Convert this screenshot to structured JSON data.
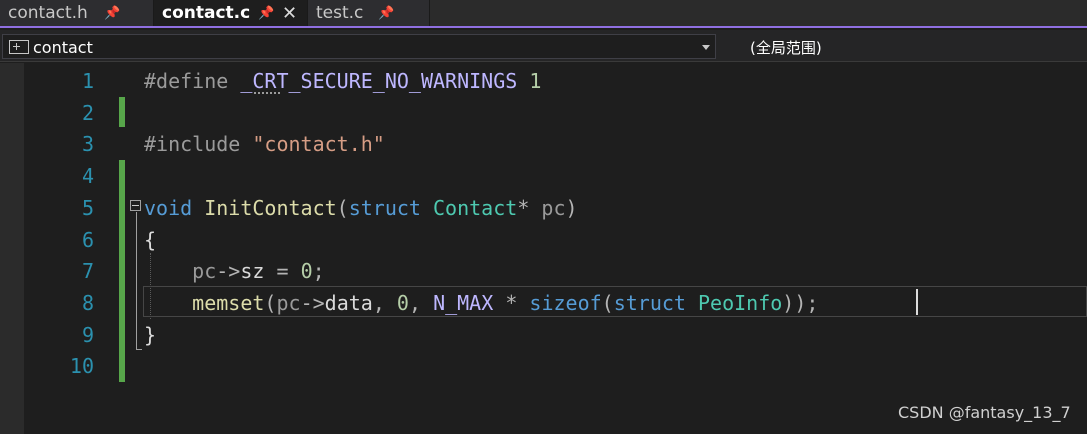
{
  "tabs": [
    {
      "label": "contact.h",
      "pin": "📌",
      "active": false
    },
    {
      "label": "contact.c",
      "pin": "📌",
      "close": "✕",
      "active": true
    },
    {
      "label": "test.c",
      "pin": "📌",
      "active": false
    }
  ],
  "navbar": {
    "scope": "contact",
    "global_scope": "(全局范围)"
  },
  "editor": {
    "line_numbers": [
      "1",
      "2",
      "3",
      "4",
      "5",
      "6",
      "7",
      "8",
      "9",
      "10"
    ],
    "code": {
      "l1": {
        "directive": "#define",
        "macro": "_CRT_SECURE_NO_WARNINGS",
        "value": "1"
      },
      "l3": {
        "directive": "#include",
        "path": "\"contact.h\""
      },
      "l5": {
        "kw_void": "void",
        "func": "InitContact",
        "paren_open": "(",
        "kw_struct": "struct",
        "type": "Contact",
        "star": "*",
        "param": "pc",
        "paren_close": ")"
      },
      "l6": {
        "brace": "{"
      },
      "l7": {
        "param": "pc",
        "arrow": "->",
        "field": "sz",
        "eq": " = ",
        "num": "0",
        "semi": ";"
      },
      "l8": {
        "func": "memset",
        "p1": "(",
        "param": "pc",
        "arrow": "->",
        "field": "data",
        "c1": ", ",
        "num": "0",
        "c2": ", ",
        "macro": "N_MAX",
        "star": " * ",
        "kw_sizeof": "sizeof",
        "p2": "(",
        "kw_struct": "struct",
        "type": "PeoInfo",
        "end": "));"
      },
      "l9": {
        "brace": "}"
      }
    }
  },
  "watermark": "CSDN @fantasy_13_7",
  "colors": {
    "accent": "#8f6fe0",
    "line_number": "#2b91af",
    "keyword": "#569cd6",
    "function": "#dcdcaa",
    "type": "#4ec9b0",
    "string": "#d69d85",
    "macro": "#beb7ff",
    "change_marker": "#57a64a"
  }
}
